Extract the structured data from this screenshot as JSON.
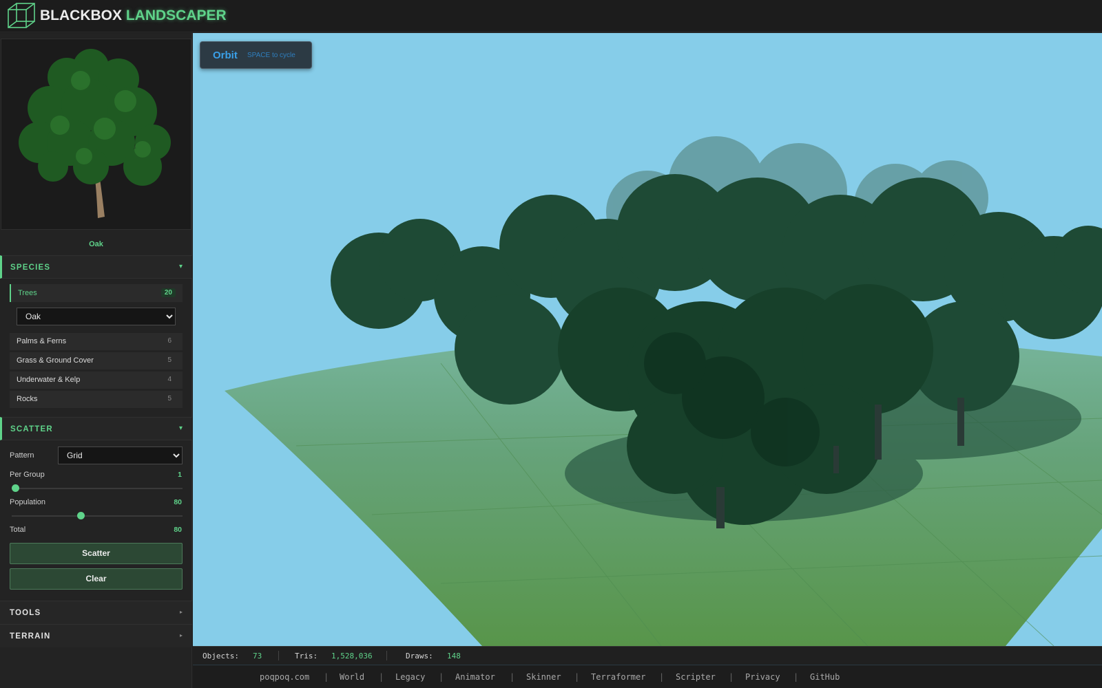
{
  "app": {
    "title_part1": "BLACKBOX",
    "title_part2": "LANDSCAPER"
  },
  "preview": {
    "species_name": "Oak"
  },
  "species": {
    "header": "SPECIES",
    "expanded_arrow": "▾",
    "active_category": {
      "label": "Trees",
      "count": "20"
    },
    "selected_species": "Oak",
    "categories": [
      {
        "label": "Palms & Ferns",
        "count": "6"
      },
      {
        "label": "Grass & Ground Cover",
        "count": "5"
      },
      {
        "label": "Underwater & Kelp",
        "count": "4"
      },
      {
        "label": "Rocks",
        "count": "5"
      }
    ]
  },
  "scatter": {
    "header": "SCATTER",
    "pattern_label": "Pattern",
    "pattern_value": "Grid",
    "per_group_label": "Per Group",
    "per_group_value": "1",
    "per_group_fraction": 0.0,
    "population_label": "Population",
    "population_value": "80",
    "population_fraction": 0.4,
    "total_label": "Total",
    "total_value": "80",
    "scatter_button": "Scatter",
    "clear_button": "Clear"
  },
  "tools": {
    "header": "TOOLS",
    "arrow": "▸"
  },
  "terrain": {
    "header": "TERRAIN",
    "arrow": "▸"
  },
  "viewport": {
    "camera_mode": "Orbit",
    "camera_hint": "SPACE to cycle"
  },
  "stats": {
    "objects_label": "Objects:",
    "objects_value": "73",
    "tris_label": "Tris:",
    "tris_value": "1,528,036",
    "draws_label": "Draws:",
    "draws_value": "148"
  },
  "footer": {
    "links": [
      "poqpoq.com",
      "World",
      "Legacy",
      "Animator",
      "Skinner",
      "Terraformer",
      "Scripter",
      "Privacy",
      "GitHub"
    ],
    "separator": "|"
  },
  "colors": {
    "accent": "#5fd38a",
    "sky": "#86cde9",
    "ground": "#5e9d58",
    "foliage": "#1d4a26",
    "orbit_text": "#3aa0e8"
  },
  "icons": {
    "logo": "wireframe-cube-icon",
    "expand": "chevron-down-icon",
    "collapse": "chevron-right-icon"
  }
}
